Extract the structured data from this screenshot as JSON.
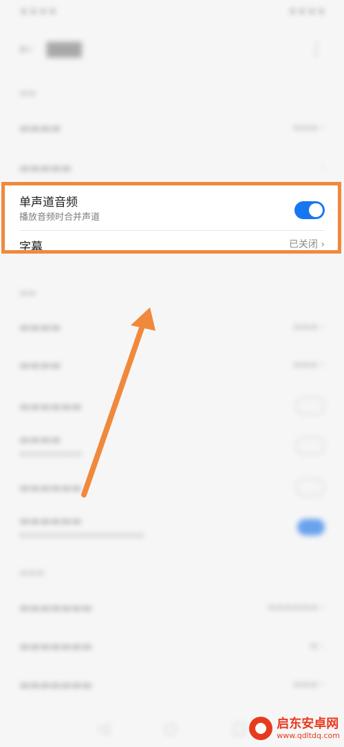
{
  "highlighted_card": {
    "mono_audio": {
      "title": "单声道音频",
      "subtitle": "播放音频时合并声道",
      "toggle_on": true
    },
    "captions": {
      "label": "字幕",
      "value": "已关闭",
      "chevron": "chevron-right-icon"
    }
  },
  "annotation": {
    "highlight_color": "#f0893b",
    "arrow_color": "#f0893b"
  },
  "accent_color": "#1976f2",
  "watermark": {
    "name": "启东安卓网",
    "url": "www.qdltdq.com"
  }
}
